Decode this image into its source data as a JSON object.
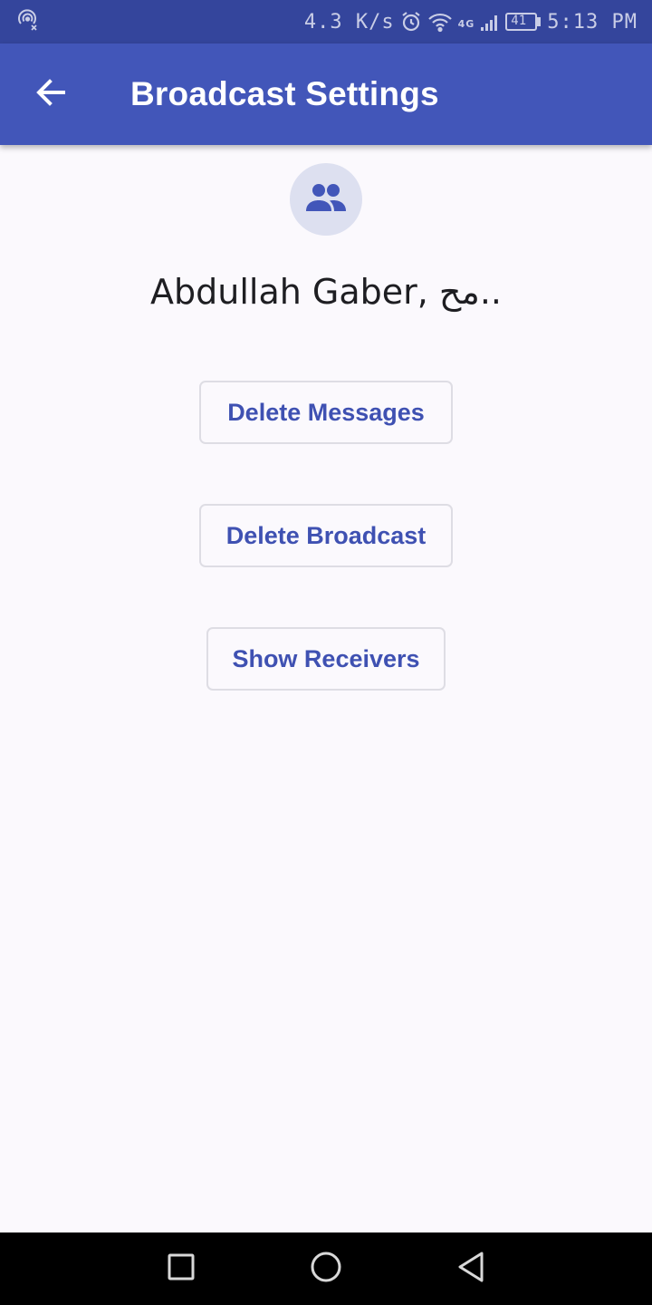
{
  "status_bar": {
    "speed": "4.3 K/s",
    "network_type": "4G",
    "battery": "41",
    "time": "5:13 PM",
    "icons": [
      "hotspot-off-icon",
      "alarm-icon",
      "wifi-icon",
      "signal-icon",
      "battery-icon"
    ]
  },
  "app_bar": {
    "title": "Broadcast Settings",
    "back_icon": "arrow-left-icon",
    "color": "#4256b9"
  },
  "avatar": {
    "icon": "group-icon",
    "background": "#dde0f0",
    "icon_color": "#4256b9"
  },
  "recipients": {
    "title": "Abdullah Gaber, مح.."
  },
  "actions": {
    "delete_messages": "Delete Messages",
    "delete_broadcast": "Delete Broadcast",
    "show_receivers": "Show Receivers",
    "text_color": "#3f51b2"
  },
  "nav_bar": {
    "icons": [
      "recent-apps-icon",
      "home-icon",
      "back-icon"
    ]
  }
}
